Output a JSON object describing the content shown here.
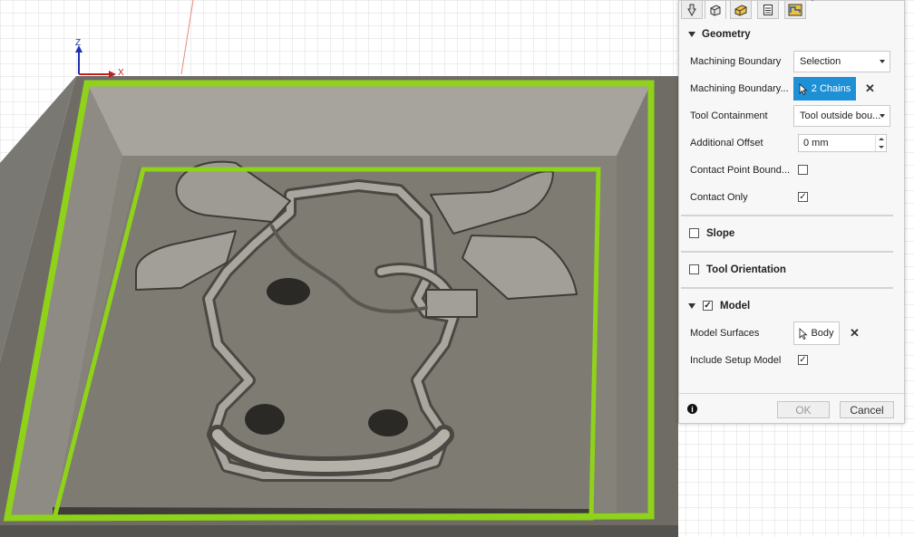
{
  "viewport": {
    "axis_z": "Z",
    "axis_x": "X",
    "boundary_color": "#8fd21a"
  },
  "panel": {
    "tabs": [
      {
        "icon": "tool-icon",
        "active": false
      },
      {
        "icon": "geometry-icon",
        "active": true
      },
      {
        "icon": "heights-icon",
        "active": false
      },
      {
        "icon": "passes-icon",
        "active": false
      },
      {
        "icon": "linking-icon",
        "active": false
      }
    ],
    "tab_extra": "°",
    "geometry": {
      "title": "Geometry",
      "machining_boundary_label": "Machining Boundary",
      "machining_boundary_value": "Selection",
      "boundary_selection_label": "Machining Boundary...",
      "boundary_selection_value": "2 Chains",
      "tool_containment_label": "Tool Containment",
      "tool_containment_value": "Tool outside bou...",
      "additional_offset_label": "Additional Offset",
      "additional_offset_value": "0 mm",
      "contact_point_label": "Contact Point Bound...",
      "contact_point_checked": false,
      "contact_only_label": "Contact Only",
      "contact_only_checked": true
    },
    "slope": {
      "title": "Slope",
      "checked": false
    },
    "tool_orientation": {
      "title": "Tool Orientation",
      "checked": false
    },
    "model": {
      "title": "Model",
      "checked": true,
      "model_surfaces_label": "Model Surfaces",
      "model_surfaces_value": "Body",
      "include_setup_label": "Include Setup Model",
      "include_setup_checked": true
    },
    "footer": {
      "ok_label": "OK",
      "cancel_label": "Cancel"
    }
  }
}
